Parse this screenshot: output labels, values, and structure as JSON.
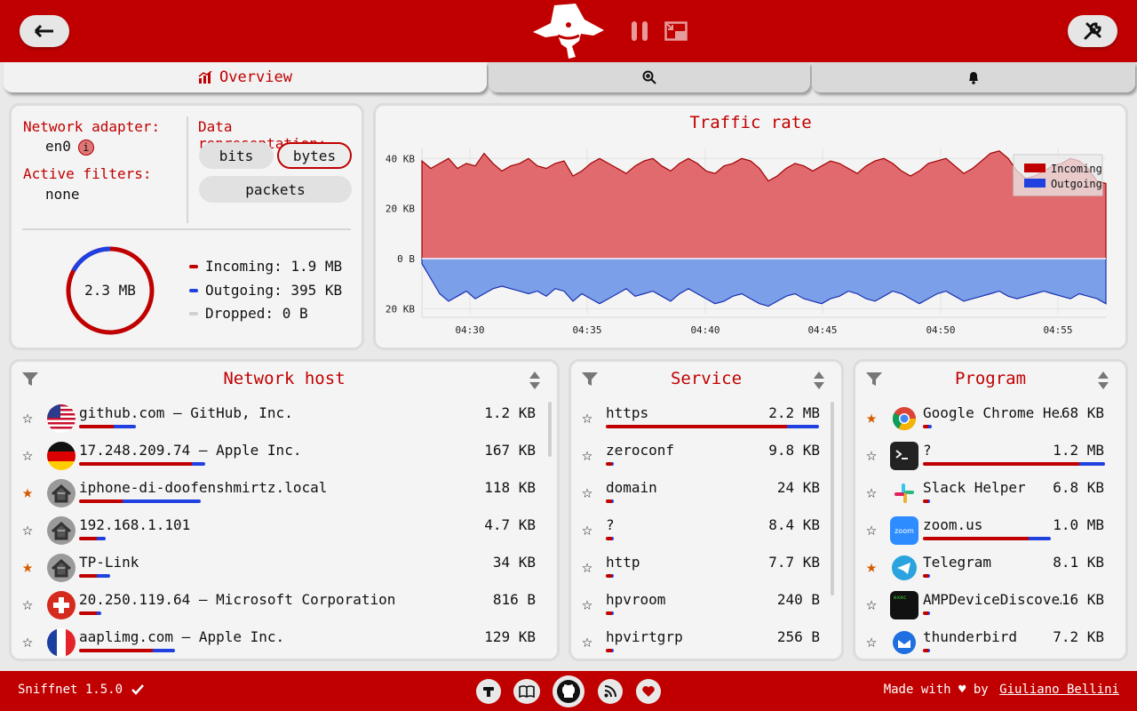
{
  "header": {
    "back_icon": "arrow-left-icon",
    "settings_icon": "wrench-icon",
    "logo": "sniffnet-logo"
  },
  "tabs": {
    "overview": "Overview",
    "inspect_icon": "zoom-in-icon",
    "notifications_icon": "bell-icon"
  },
  "summary": {
    "adapter_label": "Network adapter:",
    "adapter": "en0",
    "filters_label": "Active filters:",
    "filters": "none",
    "repr_label": "Data representation:",
    "repr_options": [
      "bits",
      "bytes",
      "packets"
    ],
    "repr_selected": "bytes",
    "total": "2.3 MB",
    "incoming": "Incoming: 1.9 MB",
    "outgoing": "Outgoing: 395 KB",
    "dropped": "Dropped: 0 B",
    "incoming_fraction": 0.83
  },
  "chart_data": {
    "type": "area",
    "title": "Traffic rate",
    "y_ticks": [
      "40 KB",
      "20 KB",
      "0 B",
      "20 KB"
    ],
    "x_ticks": [
      "04:30",
      "04:35",
      "04:40",
      "04:45",
      "04:50",
      "04:55"
    ],
    "legend": [
      "Incoming",
      "Outgoing"
    ],
    "legend_position": "top-right",
    "colors": {
      "incoming": "#e06a6e",
      "outgoing": "#7b9fe8"
    },
    "ylim": [
      -22,
      44
    ],
    "series": [
      {
        "name": "Incoming",
        "values": [
          39,
          36,
          38,
          40,
          36,
          38,
          37,
          42,
          38,
          35,
          37,
          38,
          40,
          37,
          36,
          38,
          39,
          33,
          35,
          38,
          40,
          38,
          36,
          34,
          37,
          39,
          40,
          37,
          35,
          38,
          40,
          38,
          35,
          34,
          37,
          38,
          40,
          39,
          36,
          31,
          33,
          36,
          38,
          37,
          35,
          37,
          39,
          38,
          36,
          34,
          37,
          39,
          40,
          38,
          35,
          33,
          35,
          38,
          39,
          40,
          37,
          34,
          36,
          39,
          42,
          43,
          40,
          35,
          32,
          33,
          35,
          37,
          38,
          40,
          39,
          36,
          31,
          30
        ]
      },
      {
        "name": "Outgoing",
        "values": [
          -2,
          -8,
          -14,
          -17,
          -15,
          -13,
          -16,
          -14,
          -12,
          -11,
          -12,
          -13,
          -14,
          -13,
          -15,
          -12,
          -13,
          -17,
          -14,
          -16,
          -18,
          -16,
          -14,
          -12,
          -15,
          -14,
          -13,
          -15,
          -17,
          -14,
          -12,
          -14,
          -16,
          -18,
          -17,
          -15,
          -14,
          -16,
          -18,
          -19,
          -17,
          -15,
          -14,
          -16,
          -17,
          -18,
          -16,
          -15,
          -13,
          -14,
          -16,
          -17,
          -15,
          -13,
          -14,
          -16,
          -18,
          -16,
          -14,
          -13,
          -15,
          -17,
          -16,
          -15,
          -14,
          -13,
          -15,
          -16,
          -15,
          -14,
          -13,
          -14,
          -15,
          -16,
          -14,
          -15,
          -16,
          -18
        ]
      }
    ]
  },
  "hosts": {
    "title": "Network host",
    "rows": [
      {
        "name": "github.com – GitHub, Inc.",
        "value": "1.2 KB",
        "fav": false,
        "flag": "us",
        "in": 0.08,
        "out": 0.05
      },
      {
        "name": "17.248.209.74 – Apple Inc.",
        "value": "167 KB",
        "fav": false,
        "flag": "de",
        "in": 0.26,
        "out": 0.03
      },
      {
        "name": "iphone-di-doofenshmirtz.local",
        "value": "118 KB",
        "fav": true,
        "flag": "home",
        "in": 0.1,
        "out": 0.18
      },
      {
        "name": "192.168.1.101",
        "value": "4.7 KB",
        "fav": false,
        "flag": "home",
        "in": 0.04,
        "out": 0.02
      },
      {
        "name": "TP-Link",
        "value": "34 KB",
        "fav": true,
        "flag": "home",
        "in": 0.04,
        "out": 0.03
      },
      {
        "name": "20.250.119.64 – Microsoft Corporation",
        "value": "816 B",
        "fav": false,
        "flag": "ch",
        "in": 0.04,
        "out": 0.01
      },
      {
        "name": "aaplimg.com – Apple Inc.",
        "value": "129 KB",
        "fav": false,
        "flag": "fr",
        "in": 0.17,
        "out": 0.05
      }
    ]
  },
  "services": {
    "title": "Service",
    "rows": [
      {
        "name": "https",
        "value": "2.2 MB",
        "fav": false,
        "in": 0.85,
        "out": 0.15
      },
      {
        "name": "zeroconf",
        "value": "9.8 KB",
        "fav": false,
        "in": 0.03,
        "out": 0.01
      },
      {
        "name": "domain",
        "value": "24 KB",
        "fav": false,
        "in": 0.03,
        "out": 0.01
      },
      {
        "name": "?",
        "value": "8.4 KB",
        "fav": false,
        "in": 0.03,
        "out": 0.01
      },
      {
        "name": "http",
        "value": "7.7 KB",
        "fav": false,
        "in": 0.03,
        "out": 0.01
      },
      {
        "name": "hpvroom",
        "value": "240 B",
        "fav": false,
        "in": 0.03,
        "out": 0.01
      },
      {
        "name": "hpvirtgrp",
        "value": "256 B",
        "fav": false,
        "in": 0.03,
        "out": 0.01
      }
    ]
  },
  "programs": {
    "title": "Program",
    "rows": [
      {
        "name": "Google Chrome He…",
        "value": "68 KB",
        "fav": true,
        "icon": "chrome",
        "in": 0.03,
        "out": 0.02
      },
      {
        "name": "?",
        "value": "1.2 MB",
        "fav": false,
        "icon": "terminal",
        "in": 0.86,
        "out": 0.14
      },
      {
        "name": "Slack Helper",
        "value": "6.8 KB",
        "fav": false,
        "icon": "slack",
        "in": 0.03,
        "out": 0.01
      },
      {
        "name": "zoom.us",
        "value": "1.0 MB",
        "fav": false,
        "icon": "zoom",
        "in": 0.58,
        "out": 0.12
      },
      {
        "name": "Telegram",
        "value": "8.1 KB",
        "fav": true,
        "icon": "telegram",
        "in": 0.03,
        "out": 0.01
      },
      {
        "name": "AMPDeviceDiscove…",
        "value": "16 KB",
        "fav": false,
        "icon": "exec",
        "in": 0.03,
        "out": 0.01
      },
      {
        "name": "thunderbird",
        "value": "7.2 KB",
        "fav": false,
        "icon": "thunderbird",
        "in": 0.03,
        "out": 0.01
      }
    ]
  },
  "footer": {
    "version": "Sniffnet 1.5.0",
    "made_with": "Made with ♥ by",
    "author": "Giuliano Bellini",
    "icons": [
      "news-icon",
      "book-icon",
      "github-icon",
      "rss-icon",
      "heart-icon"
    ]
  }
}
